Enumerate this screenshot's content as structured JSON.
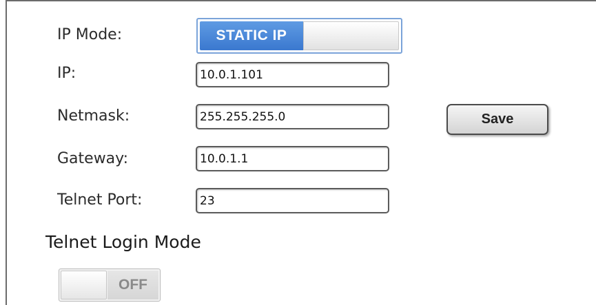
{
  "network": {
    "ip_mode_label": "IP Mode:",
    "ip_mode_value": "STATIC IP",
    "ip_label": "IP:",
    "ip_value": "10.0.1.101",
    "netmask_label": "Netmask:",
    "netmask_value": "255.255.255.0",
    "gateway_label": "Gateway:",
    "gateway_value": "10.0.1.1",
    "telnet_port_label": "Telnet Port:",
    "telnet_port_value": "23",
    "save_label": "Save"
  },
  "telnet_login": {
    "title": "Telnet Login Mode",
    "state": "OFF"
  },
  "colors": {
    "toggle_on": "#3a78cf",
    "toggle_border": "#7aa3d9",
    "toggle_off_text": "#8a8a8a"
  }
}
